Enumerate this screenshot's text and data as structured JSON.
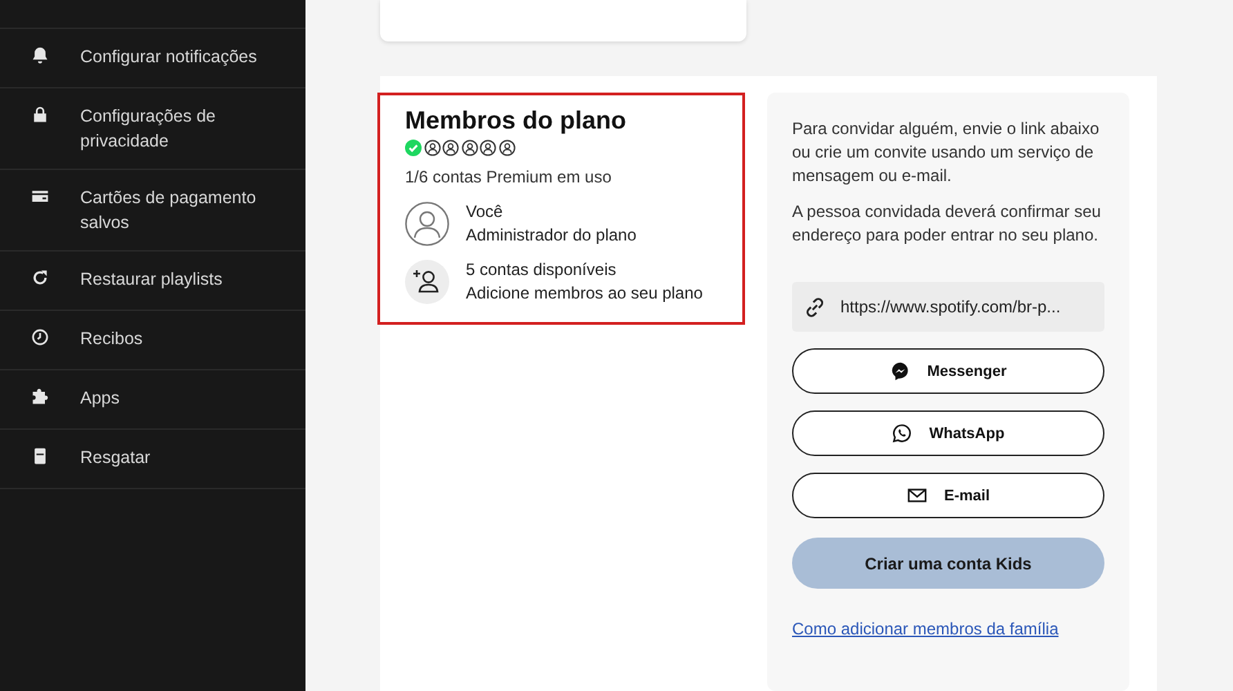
{
  "sidebar": {
    "items": [
      {
        "label": "Configurar notificações"
      },
      {
        "label": "Configurações de privacidade"
      },
      {
        "label": "Cartões de pagamento salvos"
      },
      {
        "label": "Restaurar playlists"
      },
      {
        "label": "Recibos"
      },
      {
        "label": "Apps"
      },
      {
        "label": "Resgatar"
      }
    ]
  },
  "members": {
    "title": "Membros do plano",
    "slots": [
      {
        "used": true
      },
      {
        "used": false
      },
      {
        "used": false
      },
      {
        "used": false
      },
      {
        "used": false
      },
      {
        "used": false
      }
    ],
    "usage": "1/6 contas Premium em uso",
    "rows": [
      {
        "kind": "member",
        "title": "Você",
        "subtitle": "Administrador do plano"
      },
      {
        "kind": "add",
        "title": "5 contas disponíveis",
        "subtitle": "Adicione membros ao seu plano"
      }
    ]
  },
  "invite": {
    "paragraphs": [
      "Para convidar alguém, envie o link abaixo ou crie um convite usando um serviço de mensagem ou e-mail.",
      "A pessoa convidada deverá confirmar seu endereço para poder entrar no seu plano."
    ],
    "link": "https://www.spotify.com/br-p...",
    "buttons": [
      {
        "kind": "messenger",
        "label": "Messenger"
      },
      {
        "kind": "whatsapp",
        "label": "WhatsApp"
      },
      {
        "kind": "email",
        "label": "E-mail"
      }
    ],
    "kids_button": "Criar uma conta Kids",
    "help_link": "Como adicionar membros da família"
  }
}
